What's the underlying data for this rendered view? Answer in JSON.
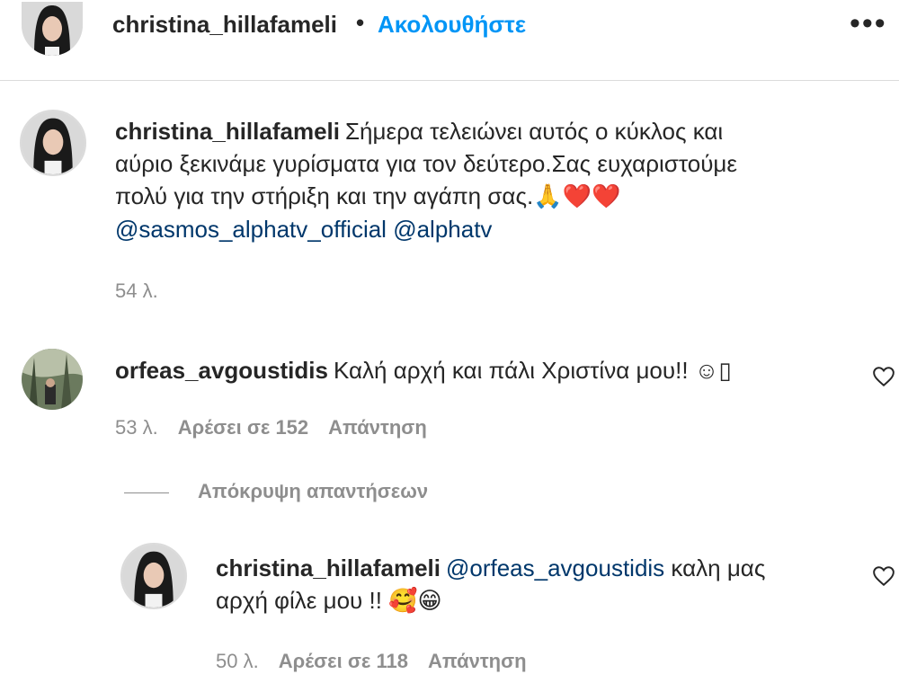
{
  "header": {
    "username": "christina_hillafameli",
    "separator": "•",
    "follow_label": "Ακολουθήστε",
    "more_label": "•••"
  },
  "caption": {
    "username": "christina_hillafameli",
    "text_line1": "Σήμερα τελειώνει αυτός ο κύκλος και",
    "text_line2": "αύριο ξεκινάμε γυρίσματα για τον δεύτερο.Σας ευχαριστούμε",
    "text_line3": "πολύ για την στήριξη και την αγάπη σας.",
    "emoji": "🙏❤️❤️",
    "mention1": "@sasmos_alphatv_official",
    "mention2": "@alphatv",
    "time": "54 λ."
  },
  "comment": {
    "username": "orfeas_avgoustidis",
    "text": "Καλή αρχή και πάλι Χριστίνα μου!! ☺▯",
    "time": "53 λ.",
    "likes": "Αρέσει σε 152",
    "reply_label": "Απάντηση",
    "hide_replies_label": "Απόκρυψη απαντήσεων"
  },
  "reply": {
    "username": "christina_hillafameli",
    "mention": "@orfeas_avgoustidis",
    "text_line1": "καλη μας",
    "text_line2": "αρχή φίλε μου !!",
    "emoji": "🥰😁",
    "time": "50 λ.",
    "likes": "Αρέσει σε 118",
    "reply_label": "Απάντηση"
  },
  "colors": {
    "link_blue": "#0095f6",
    "mention_blue": "#00376b",
    "muted_gray": "#8e8e8e",
    "text": "#262626"
  }
}
